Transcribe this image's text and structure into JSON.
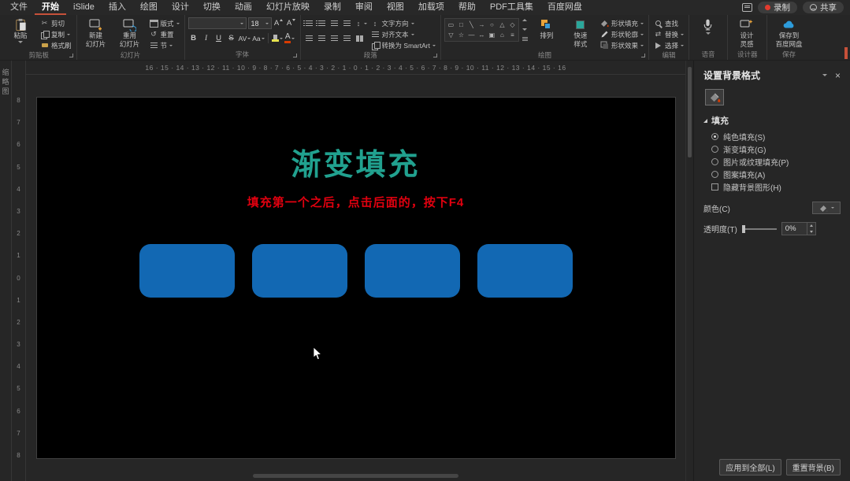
{
  "colors": {
    "accent": "#C7513A",
    "title_teal": "#21A18F",
    "subtitle_red": "#E1000F",
    "shape_blue": "#1268B3",
    "bucket_red": "#D83B01"
  },
  "menubar": {
    "tabs": [
      "文件",
      "开始",
      "iSlide",
      "插入",
      "绘图",
      "设计",
      "切换",
      "动画",
      "幻灯片放映",
      "录制",
      "审阅",
      "视图",
      "加载项",
      "帮助",
      "PDF工具集",
      "百度网盘"
    ],
    "active_tab": "开始",
    "record_label": "录制",
    "share_label": "共享"
  },
  "ribbon": {
    "group_labels": [
      "剪贴板",
      "幻灯片",
      "字体",
      "段落",
      "绘图",
      "编辑",
      "语音",
      "设计器",
      "保存"
    ],
    "clipboard": {
      "paste": "粘贴",
      "cut": "剪切",
      "copy": "复制",
      "painter": "格式刷"
    },
    "slides": {
      "new_l1": "新建",
      "new_l2": "幻灯片",
      "reuse_l1": "重用",
      "reuse_l2": "幻灯片",
      "layout": "版式",
      "reset": "重置",
      "section": "节"
    },
    "font": {
      "size": "18",
      "bold": "B",
      "italic": "I",
      "underline": "U",
      "strike": "S",
      "spacing": "AV",
      "case": "Aa",
      "color_letter": "A",
      "grow": "A",
      "shrink": "A"
    },
    "paragraph": {
      "text_direction": "文字方向",
      "align_text": "对齐文本",
      "smartart": "转换为 SmartArt"
    },
    "drawing": {
      "gallery_row1": [
        "▭",
        "□",
        "╲",
        "→",
        "○",
        "△",
        "◇"
      ],
      "gallery_row2": [
        "▽",
        "☆",
        "—",
        "↔",
        "▣",
        "⌂",
        "≡"
      ],
      "arrange": "排列",
      "quick_l1": "快速",
      "quick_l2": "样式",
      "shape_fill": "形状填充",
      "shape_outline": "形状轮廓",
      "shape_effects": "形状效果"
    },
    "editing": {
      "find": "查找",
      "replace": "替换",
      "select": "选择"
    },
    "design": {
      "l1": "设计",
      "l2": "灵感"
    },
    "save": {
      "l1": "保存到",
      "l2": "百度网盘"
    }
  },
  "left_pane": {
    "label": "缩略图"
  },
  "rulers": {
    "horizontal": [
      16,
      15,
      14,
      13,
      12,
      11,
      10,
      9,
      8,
      7,
      6,
      5,
      4,
      3,
      2,
      1,
      0,
      1,
      2,
      3,
      4,
      5,
      6,
      7,
      8,
      9,
      10,
      11,
      12,
      13,
      14,
      15,
      16
    ],
    "vertical": [
      8,
      7,
      6,
      5,
      4,
      3,
      2,
      1,
      0,
      1,
      2,
      3,
      4,
      5,
      6,
      7,
      8
    ]
  },
  "slide": {
    "title": "渐变填充",
    "subtitle": "填充第一个之后，点击后面的，按下F4",
    "shape_count": 4
  },
  "panel": {
    "title": "设置背景格式",
    "fill_section": "填充",
    "options": [
      {
        "label": "纯色填充(S)",
        "type": "radio",
        "selected": true
      },
      {
        "label": "渐变填充(G)",
        "type": "radio",
        "selected": false
      },
      {
        "label": "图片或纹理填充(P)",
        "type": "radio",
        "selected": false
      },
      {
        "label": "图案填充(A)",
        "type": "radio",
        "selected": false
      },
      {
        "label": "隐藏背景图形(H)",
        "type": "checkbox",
        "selected": false
      }
    ],
    "color_label": "颜色(C)",
    "transparency_label": "透明度(T)",
    "transparency_value": "0%",
    "apply_all": "应用到全部(L)",
    "reset_bg": "重置背景(B)"
  }
}
